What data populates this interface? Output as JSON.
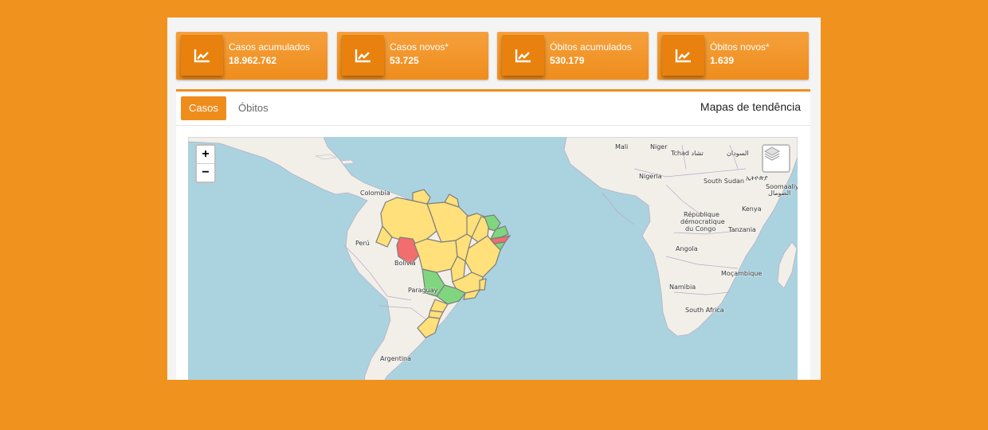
{
  "stats": [
    {
      "label": "Casos acumulados",
      "value": "18.962.762",
      "icon": "trending-up-icon"
    },
    {
      "label": "Casos novos*",
      "value": "53.725",
      "icon": "trending-up-icon"
    },
    {
      "label": "Óbitos acumulados",
      "value": "530.179",
      "icon": "trending-up-icon"
    },
    {
      "label": "Óbitos novos*",
      "value": "1.639",
      "icon": "trending-up-icon"
    }
  ],
  "tabs": [
    {
      "label": "Casos",
      "active": true
    },
    {
      "label": "Óbitos",
      "active": false
    }
  ],
  "card_title": "Mapas de tendência",
  "map": {
    "zoom_in": "+",
    "zoom_out": "−",
    "layers_icon": "layers-icon",
    "labels": {
      "mali": "Mali",
      "niger": "Niger",
      "tchad": "Tchad تشاد",
      "sudan": "السودان",
      "nigeria": "Nigeria",
      "south_sudan": "South Sudan",
      "ethiopia": "ኢትዮጵያ",
      "somalia": "Soomaaliya",
      "somalia_ar": "الصومال",
      "colombia": "Colombia",
      "kenya": "Kenya",
      "rdc1": "République",
      "rdc2": "démocratique",
      "rdc3": "du Congo",
      "tanzania": "Tanzania",
      "peru": "Perú",
      "bolivia": "Bolivia",
      "angola": "Angola",
      "mozambique": "Moçambique",
      "paraguay": "Paraguay",
      "namibia": "Namibia",
      "south_africa": "South Africa",
      "argentina": "Argentina"
    }
  },
  "colors": {
    "background": "#f0921e",
    "accent": "#ef8d1c",
    "state_yellow": "#ffe07a",
    "state_green": "#7fd67f",
    "state_red": "#f26d6d",
    "land": "#f2efe9",
    "water": "#aad3df"
  }
}
